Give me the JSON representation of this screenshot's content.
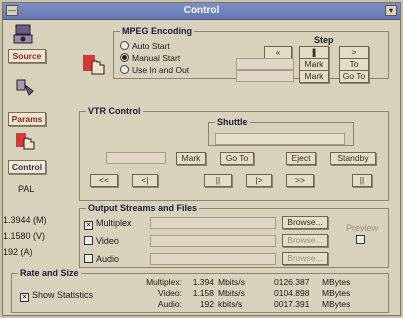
{
  "window": {
    "title": "Control"
  },
  "left": {
    "tabs": [
      "Source",
      "Params",
      "Control"
    ],
    "format": "PAL",
    "rates": [
      "1.3944 (M)",
      "1.1580 (V)",
      "192 (A)"
    ]
  },
  "mpeg": {
    "title": "MPEG Encoding",
    "options": [
      "Auto Start",
      "Manual Start",
      "Use In and Out"
    ],
    "selected_option": "Manual Start",
    "step_label": "Step",
    "mark_label": "Mark",
    "to_label": "To",
    "goto_label": "Go To"
  },
  "vtr": {
    "title": "VTR Control",
    "shuttle_label": "Shuttle",
    "mark_label": "Mark",
    "goto_label": "Go To",
    "eject_label": "Eject",
    "standby_label": "Standby",
    "transport": [
      "<<",
      "<|",
      "||",
      "|>",
      ">>",
      "||"
    ]
  },
  "output": {
    "title": "Output Streams and Files",
    "rows": [
      {
        "label": "Multiplex",
        "checked": true
      },
      {
        "label": "Video",
        "checked": false
      },
      {
        "label": "Audio",
        "checked": false
      }
    ],
    "browse_label": "Browse...",
    "preview_label": "Preview"
  },
  "rate": {
    "title": "Rate and Size",
    "show_stats_label": "Show Statistics",
    "show_stats_checked": true,
    "rows": [
      {
        "name": "Multiplex:",
        "rate": "1.394",
        "rate_unit": "Mbits/s",
        "size": "0126.387",
        "size_unit": "MBytes"
      },
      {
        "name": "Video:",
        "rate": "1.158",
        "rate_unit": "Mbits/s",
        "size": "0104.898",
        "size_unit": "MBytes"
      },
      {
        "name": "Audio:",
        "rate": "192",
        "rate_unit": "kbits/s",
        "size": "0017.391",
        "size_unit": "MBytes"
      }
    ]
  }
}
